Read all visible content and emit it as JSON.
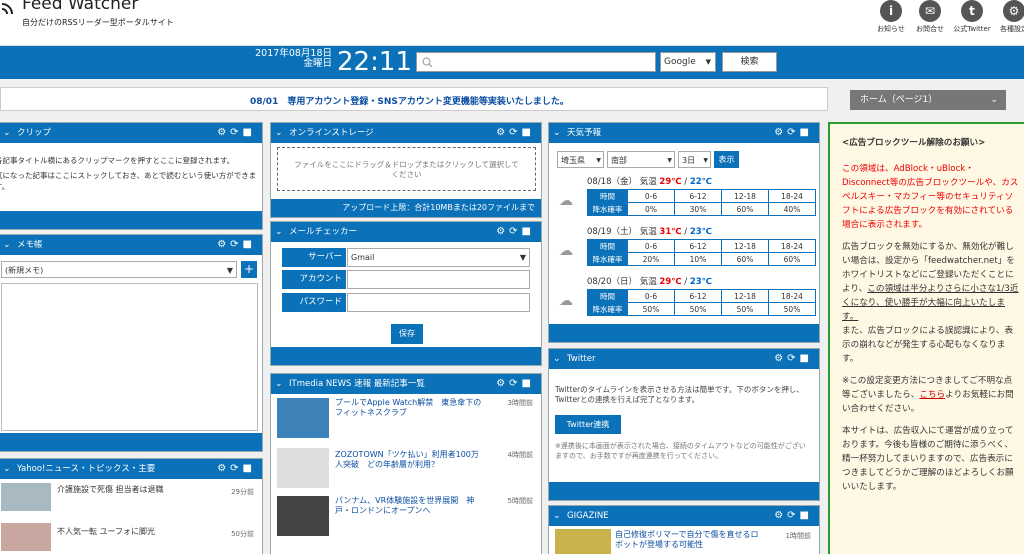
{
  "header": {
    "title": "Feed Watcher",
    "subtitle": "自分だけのRSSリーダー型ポータルサイト",
    "icons": [
      {
        "label": "お知らせ",
        "icon": "info-icon",
        "glyph": "i"
      },
      {
        "label": "お問合せ",
        "icon": "mail-icon",
        "glyph": "✉"
      },
      {
        "label": "公式Twitter",
        "icon": "twitter-icon",
        "glyph": "t"
      },
      {
        "label": "各種設定",
        "icon": "gear-icon",
        "glyph": "⚙"
      }
    ]
  },
  "bar": {
    "date": "2017年08月18日",
    "weekday": "金曜日",
    "time": "22:11",
    "engine": "Google",
    "search_button": "検索"
  },
  "news": "08/01　専用アカウント登録・SNSアカウント変更機能等実装いたしました。",
  "page_select": "ホーム（ページ1）",
  "clip": {
    "title": "クリップ",
    "text1": "各記事タイトル横にあるクリップマークを押すとここに登録されます。",
    "text2": "気になった記事はここにストックしておき、あとで読むという使い方ができます。"
  },
  "memo": {
    "title": "メモ帳",
    "select": "(新規メモ)",
    "add": "+"
  },
  "yahoo": {
    "title": "Yahoo!ニュース・トピックス・主要",
    "items": [
      {
        "title": "介護施設で死傷 担当者は退職",
        "time": "29分前"
      },
      {
        "title": "不人気一転 ユーフォに脚光",
        "time": "50分前"
      }
    ]
  },
  "storage": {
    "title": "オンラインストレージ",
    "drop": "ファイルをここにドラッグ＆ドロップまたはクリックして選択してください",
    "limit": "アップロード上限：合計10MBまたは20ファイルまで"
  },
  "mail": {
    "title": "メールチェッカー",
    "server_label": "サーバー",
    "server": "Gmail",
    "account_label": "アカウント",
    "password_label": "パスワード",
    "save": "保存"
  },
  "itmedia": {
    "title": "ITmedia NEWS 速報 最新記事一覧",
    "items": [
      {
        "title": "プールでApple Watch解禁　東急傘下のフィットネスクラブ",
        "time": "3時間前"
      },
      {
        "title": "ZOZOTOWN「ツケ払い」利用者100万人突破　どの年齢層が利用？",
        "time": "4時間前"
      },
      {
        "title": "パンナム、VR体験施設を世界展開　神戸・ロンドンにオープンへ",
        "time": "5時間前"
      }
    ]
  },
  "weather": {
    "title": "天気予報",
    "pref": "埼玉県",
    "area": "南部",
    "days": "3日",
    "show": "表示",
    "temp_label": "気温",
    "hours": [
      "0-6",
      "6-12",
      "12-18",
      "18-24"
    ],
    "row_time": "時間",
    "row_rain": "降水確率",
    "rows": [
      {
        "date": "08/18（金）",
        "max": "29℃",
        "min": "22℃",
        "rain": [
          "0%",
          "30%",
          "60%",
          "40%"
        ]
      },
      {
        "date": "08/19（土）",
        "max": "31℃",
        "min": "23℃",
        "rain": [
          "20%",
          "10%",
          "60%",
          "60%"
        ]
      },
      {
        "date": "08/20（日）",
        "max": "29℃",
        "min": "23℃",
        "rain": [
          "50%",
          "50%",
          "50%",
          "50%"
        ]
      }
    ]
  },
  "twitter": {
    "title": "Twitter",
    "text": "Twitterのタイムラインを表示させる方法は簡単です。下のボタンを押し、Twitterとの連携を行えば完了となります。",
    "button": "Twitter連携",
    "note": "※連携後に本画面が表示された場合、接続のタイムアウトなどの可能性がございますので、お手数ですが再度連携を行ってください。"
  },
  "gigazine": {
    "title": "GIGAZINE",
    "item": "自己修復ポリマーで自分で傷を直せるロボットが登場する可能性",
    "time": "1時間前"
  },
  "ad": {
    "title": "<広告ブロックツール解除のお願い>",
    "red": "この領域は、AdBlock・uBlock・Disconnect等の広告ブロックツールや、カスペルスキー・マカフィー等のセキュリティソフトによる広告ブロックを有効にされている場合に表示されます。",
    "p2": "広告ブロックを無効にするか、無効化が難しい場合は、設定から「feedwatcher.net」をホワイトリストなどにご登録いただくことにより、",
    "p2u": "この領域は半分よりさらに小さな1/3近くになり、使い勝手が大幅に向上いたします。",
    "p2b": "また、広告ブロックによる誤認識により、表示の崩れなどが発生する心配もなくなります。",
    "p3a": "※この設定変更方法につきましてご不明な点等ございましたら、",
    "p3link": "こちら",
    "p3b": "よりお気軽にお問い合わせください。",
    "p4": "本サイトは、広告収入にて運営が成り立っております。今後も皆様のご期待に添うべく、精一杯努力してまいりますので、広告表示につきましてどうかご理解のほどよろしくお願いいたします。"
  }
}
